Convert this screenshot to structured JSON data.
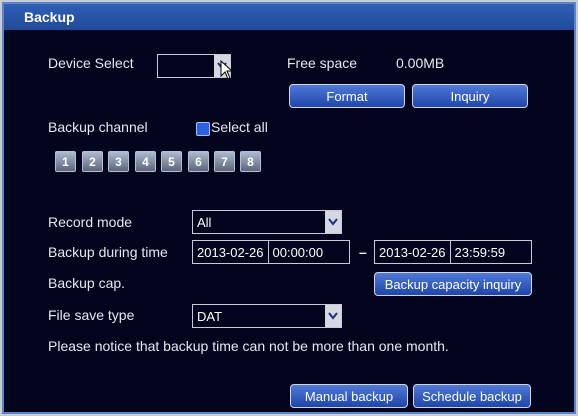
{
  "window": {
    "title": "Backup"
  },
  "device": {
    "label": "Device Select",
    "value": ""
  },
  "free_space": {
    "label": "Free space",
    "value": "0.00MB"
  },
  "buttons": {
    "format": "Format",
    "inquiry": "Inquiry",
    "capacity_inquiry": "Backup capacity inquiry",
    "manual_backup": "Manual backup",
    "schedule_backup": "Schedule backup"
  },
  "backup_channel": {
    "label": "Backup channel",
    "select_all": "Select all",
    "channels": [
      "1",
      "2",
      "3",
      "4",
      "5",
      "6",
      "7",
      "8"
    ]
  },
  "record_mode": {
    "label": "Record mode",
    "value": "All"
  },
  "backup_time": {
    "label": "Backup during time",
    "start_date": "2013-02-26",
    "start_time": "00:00:00",
    "separator": "–",
    "end_date": "2013-02-26",
    "end_time": "23:59:59"
  },
  "backup_cap": {
    "label": "Backup cap."
  },
  "file_save_type": {
    "label": "File save type",
    "value": "DAT"
  },
  "notice": "Please notice that backup time can not be more than one month.",
  "colors": {
    "window_bg": "#03041e",
    "titlebar": "#2f5fb6",
    "button": "#2a55be",
    "checkbox": "#2b62e0"
  }
}
